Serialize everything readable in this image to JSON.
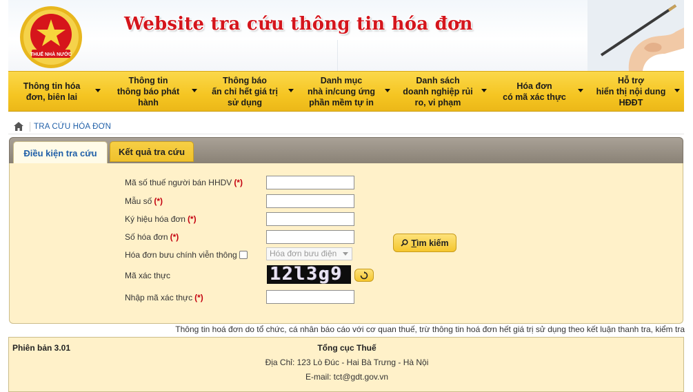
{
  "banner": {
    "title": "Website tra cứu thông tin hóa đơn",
    "emblem_text": "THUẾ NHÀ NƯỚC"
  },
  "nav": {
    "items": [
      {
        "label": "Thông tin hóa\nđơn, biên lai"
      },
      {
        "label": "Thông tin\nthông báo phát\nhành"
      },
      {
        "label": "Thông báo\nấn chỉ hết giá trị\nsử dụng"
      },
      {
        "label": "Danh mục\nnhà in/cung ứng\nphần mềm tự in"
      },
      {
        "label": "Danh sách\ndoanh nghiệp rủi\nro, vi phạm"
      },
      {
        "label": "Hóa đơn\ncó mã xác thực"
      },
      {
        "label": "Hỗ trợ\nhiển thị nội dung\nHĐĐT"
      }
    ]
  },
  "breadcrumb": {
    "current": "TRA CỨU HÓA ĐƠN"
  },
  "tabs": {
    "active": "Điều kiện tra cứu",
    "inactive": "Kết quả tra cứu"
  },
  "form": {
    "required_mark": "(*)",
    "seller_tax_code": {
      "label": "Mã số thuế người bán HHDV",
      "value": ""
    },
    "form_no": {
      "label": "Mẫu số",
      "value": ""
    },
    "symbol": {
      "label": "Ký hiệu hóa đơn",
      "value": ""
    },
    "invoice_no": {
      "label": "Số hóa đơn",
      "value": ""
    },
    "postal_invoice": {
      "label": "Hóa đơn bưu chính viễn thông",
      "checked": false,
      "select_value": "Hóa đơn bưu điện"
    },
    "captcha": {
      "label": "Mã xác thực",
      "image_text": "12l3g9"
    },
    "captcha_input": {
      "label": "Nhập mã xác thực",
      "value": ""
    },
    "search_button": {
      "hotkey": "T",
      "rest": "ìm kiếm"
    }
  },
  "notice": "Thông tin hoá đơn do tổ chức, cá nhân báo cáo với cơ quan thuế, trừ thông tin hoá đơn hết giá trị sử dụng theo kết luận thanh tra, kiểm tra",
  "footer": {
    "version": "Phiên bản 3.01",
    "org": "Tổng cục Thuế",
    "address": "Địa Chỉ: 123 Lò Đúc - Hai Bà Trưng - Hà Nội",
    "email": "E-mail: tct@gdt.gov.vn"
  },
  "colors": {
    "accent_yellow": "#f5c522",
    "panel_bg": "#fff1c9",
    "title_red": "#d4151c",
    "link_blue": "#1f5fa8",
    "required_red": "#c4000f"
  }
}
